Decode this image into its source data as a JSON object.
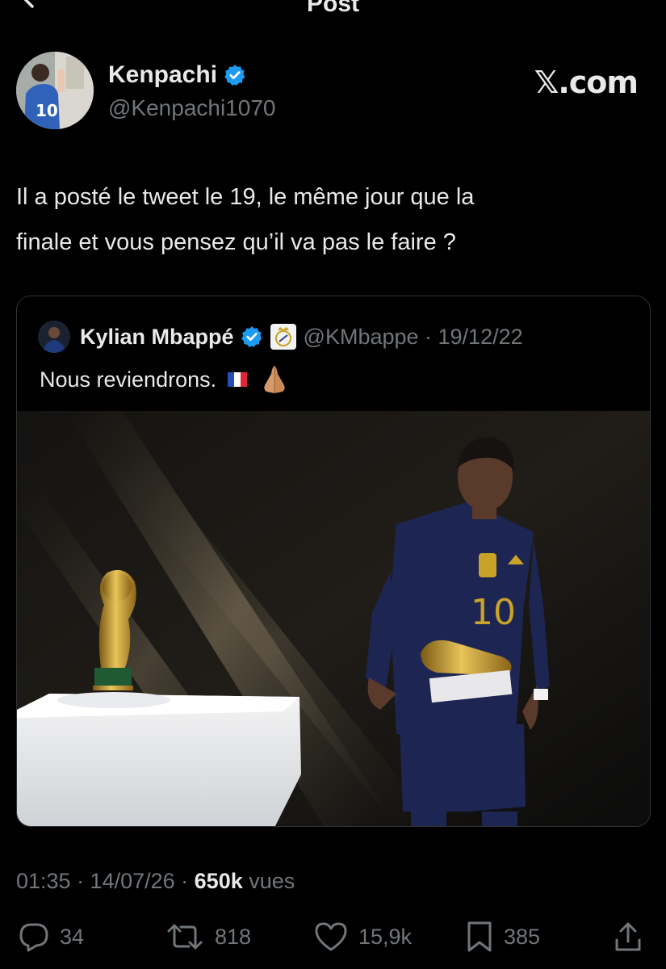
{
  "header": {
    "title": "Post"
  },
  "author": {
    "name": "Kenpachi",
    "handle": "@Kenpachi1070",
    "verified": true,
    "avatar_jersey_number": "10"
  },
  "watermark": "𝕏.com",
  "tweet": {
    "text_line1": "Il a posté le tweet le 19, le même jour que la",
    "text_line2": "finale et vous pensez qu’il va pas le faire ?"
  },
  "quoted": {
    "name": "Kylian Mbappé",
    "handle_date": "@KMbappe · 19/12/22",
    "verified": true,
    "affiliate_badge": "real-madrid-crest",
    "text": "Nous reviendrons.",
    "emojis": [
      "flag-france",
      "folded-hands"
    ],
    "media": {
      "jersey_number": "10",
      "description_icon": "trophy-and-player-photo"
    }
  },
  "meta": {
    "time_date": "01:35 · 14/07/26 · ",
    "views_count": "650k",
    "views_label": " vues"
  },
  "actions": {
    "replies": "34",
    "reposts": "818",
    "likes": "15,9k",
    "bookmarks": "385"
  },
  "colors": {
    "background": "#000000",
    "text": "#e7e9ea",
    "muted": "#71767b",
    "verified_blue": "#1d9bf0",
    "border": "#2f3336"
  }
}
